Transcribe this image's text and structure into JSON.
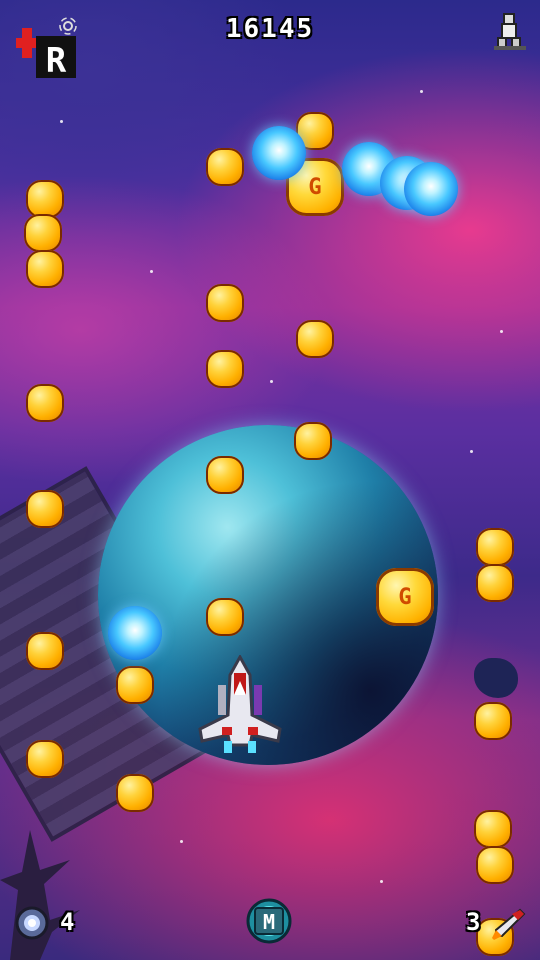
{
  "hud": {
    "score": "16145",
    "bomb_count": "4",
    "missile_count": "3",
    "special_button_label": "M",
    "logo_label": "R"
  },
  "icons": {
    "logo": "logo-icon",
    "pilot": "pilot-icon",
    "bomb": "bomb-icon",
    "special": "m-button-icon",
    "missile": "missile-icon"
  },
  "pickups": {
    "gold_coin_label": "G"
  },
  "colors": {
    "coin": "#ffb000",
    "gem": "#48c8ff",
    "logo_red": "#e02020",
    "planet": "#1f7fa8"
  }
}
